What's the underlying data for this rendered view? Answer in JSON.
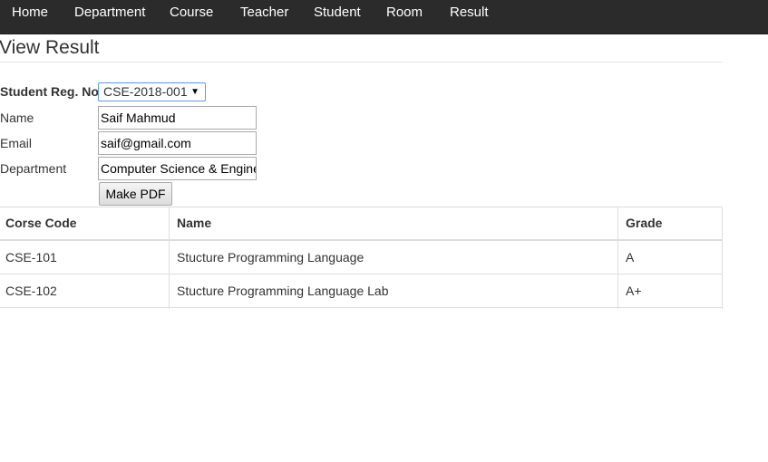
{
  "nav": {
    "items": [
      {
        "label": "Home"
      },
      {
        "label": "Department"
      },
      {
        "label": "Course"
      },
      {
        "label": "Teacher"
      },
      {
        "label": "Student"
      },
      {
        "label": "Room"
      },
      {
        "label": "Result"
      }
    ]
  },
  "page": {
    "title": "View Result"
  },
  "form": {
    "reg_label": "Student Reg. No",
    "reg_value": "CSE-2018-001",
    "name_label": "Name",
    "name_value": "Saif Mahmud",
    "email_label": "Email",
    "email_value": "saif@gmail.com",
    "department_label": "Department",
    "department_value": "Computer Science & Engineering",
    "pdf_button_label": "Make PDF"
  },
  "table": {
    "headers": [
      "Corse Code",
      "Name",
      "Grade"
    ],
    "rows": [
      {
        "code": "CSE-101",
        "name": "Stucture Programming Language",
        "grade": "A"
      },
      {
        "code": "CSE-102",
        "name": "Stucture Programming Language Lab",
        "grade": "A+"
      }
    ]
  },
  "colors": {
    "navbar_bg": "#2b2b2b",
    "nav_text": "#ffffff",
    "border": "#dddddd",
    "select_focus": "#5b9ae8"
  }
}
